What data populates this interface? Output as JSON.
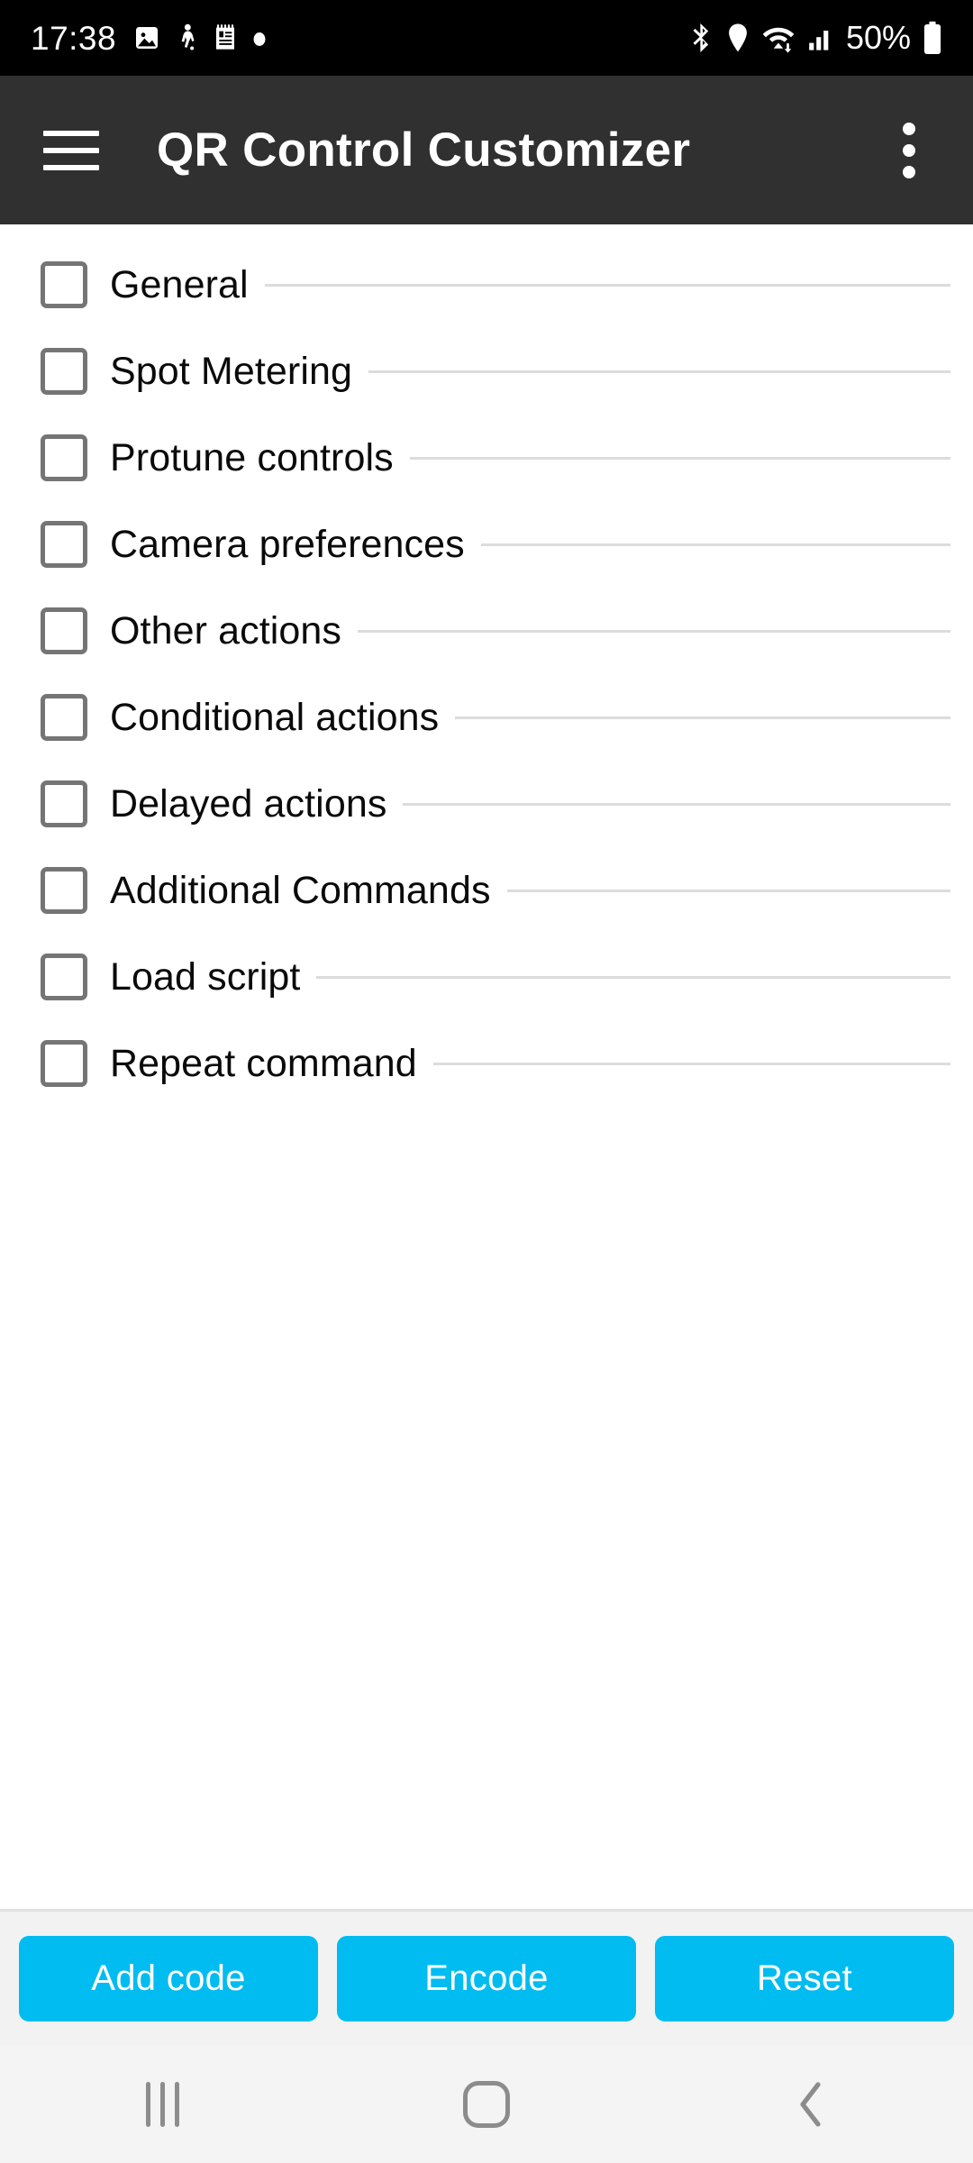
{
  "status_bar": {
    "time": "17:38",
    "battery_percent": "50%",
    "left_icons": [
      "image-icon",
      "person-walking-icon",
      "notepad-icon",
      "dot-icon"
    ],
    "right_icons": [
      "bluetooth-icon",
      "location-pin-icon",
      "wifi-icon",
      "cellular-signal-icon",
      "battery-icon"
    ],
    "background_color": "#000000"
  },
  "app_bar": {
    "title": "QR Control Customizer",
    "menu_icon": "hamburger-menu-icon",
    "overflow_icon": "overflow-menu-icon",
    "background_color": "#303030"
  },
  "list": {
    "items": [
      {
        "label": "General",
        "checked": false
      },
      {
        "label": "Spot Metering",
        "checked": false
      },
      {
        "label": "Protune controls",
        "checked": false
      },
      {
        "label": "Camera preferences",
        "checked": false
      },
      {
        "label": "Other actions",
        "checked": false
      },
      {
        "label": "Conditional actions",
        "checked": false
      },
      {
        "label": "Delayed actions",
        "checked": false
      },
      {
        "label": "Additional Commands",
        "checked": false
      },
      {
        "label": "Load script",
        "checked": false
      },
      {
        "label": "Repeat command",
        "checked": false
      }
    ]
  },
  "button_bar": {
    "buttons": [
      {
        "label": "Add code"
      },
      {
        "label": "Encode"
      },
      {
        "label": "Reset"
      }
    ],
    "accent_color": "#00bcf0",
    "background_color": "#f2f2f2"
  },
  "nav_bar": {
    "recents_icon": "recents-icon",
    "home_icon": "home-icon",
    "back_icon": "back-icon",
    "background_color": "#f4f4f4"
  }
}
